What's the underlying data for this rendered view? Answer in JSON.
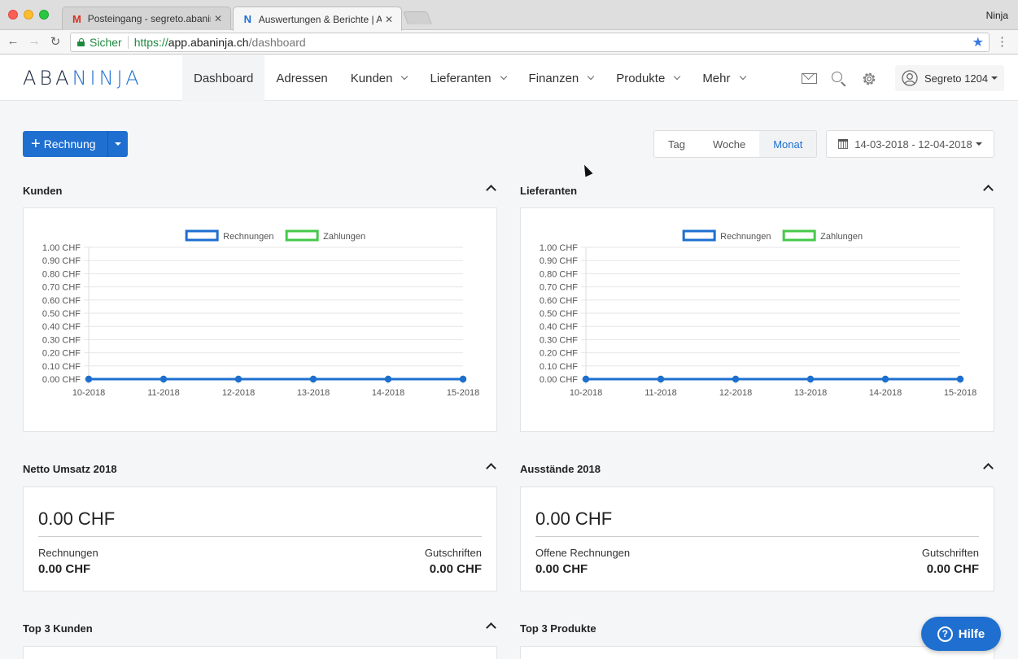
{
  "browser": {
    "tabs": [
      {
        "icon": "M",
        "title": "Posteingang - segreto.abaninja",
        "active": false,
        "icon_color": "#d93025"
      },
      {
        "icon": "N",
        "title": "Auswertungen & Berichte | Aba",
        "active": true,
        "icon_color": "#1e6fd0"
      }
    ],
    "profile_name": "Ninja",
    "address": {
      "secure_label": "Sicher",
      "scheme": "https://",
      "host": "app.abaninja.ch",
      "path": "/dashboard"
    }
  },
  "app": {
    "logo": {
      "part1": "ABA",
      "part2": "NINJA"
    },
    "nav": [
      {
        "label": "Dashboard",
        "active": true,
        "has_menu": false
      },
      {
        "label": "Adressen",
        "active": false,
        "has_menu": false
      },
      {
        "label": "Kunden",
        "active": false,
        "has_menu": true
      },
      {
        "label": "Lieferanten",
        "active": false,
        "has_menu": true
      },
      {
        "label": "Finanzen",
        "active": false,
        "has_menu": true
      },
      {
        "label": "Produkte",
        "active": false,
        "has_menu": true
      },
      {
        "label": "Mehr",
        "active": false,
        "has_menu": true
      }
    ],
    "user": {
      "name": "Segreto 1204"
    },
    "colors": {
      "primary": "#1e6fd0",
      "invoices_series": "#1e6fd0",
      "payments_series": "#45c94a"
    }
  },
  "toolbar": {
    "new_invoice_label": "Rechnung",
    "periods": [
      {
        "label": "Tag",
        "active": false
      },
      {
        "label": "Woche",
        "active": false
      },
      {
        "label": "Monat",
        "active": true
      }
    ],
    "date_range": "14-03-2018 - 12-04-2018"
  },
  "panels": {
    "customers": {
      "title": "Kunden"
    },
    "suppliers": {
      "title": "Lieferanten"
    },
    "net_revenue": {
      "title": "Netto Umsatz 2018",
      "total": "0.00 CHF",
      "left_label": "Rechnungen",
      "left_value": "0.00 CHF",
      "right_label": "Gutschriften",
      "right_value": "0.00 CHF"
    },
    "outstanding": {
      "title": "Ausstände 2018",
      "total": "0.00 CHF",
      "left_label": "Offene Rechnungen",
      "left_value": "0.00 CHF",
      "right_label": "Gutschriften",
      "right_value": "0.00 CHF"
    },
    "top_customers": {
      "title": "Top 3 Kunden"
    },
    "top_products": {
      "title": "Top 3 Produkte"
    }
  },
  "help": {
    "label": "Hilfe"
  },
  "chart_data": [
    {
      "type": "line",
      "categories": [
        "10-2018",
        "11-2018",
        "12-2018",
        "13-2018",
        "14-2018",
        "15-2018"
      ],
      "series": [
        {
          "name": "Rechnungen",
          "values": [
            0,
            0,
            0,
            0,
            0,
            0
          ]
        },
        {
          "name": "Zahlungen",
          "values": [
            0,
            0,
            0,
            0,
            0,
            0
          ]
        }
      ],
      "y_ticks": [
        "0.00 CHF",
        "0.10 CHF",
        "0.20 CHF",
        "0.30 CHF",
        "0.40 CHF",
        "0.50 CHF",
        "0.60 CHF",
        "0.70 CHF",
        "0.80 CHF",
        "0.90 CHF",
        "1.00 CHF"
      ],
      "ylim": [
        0,
        1
      ],
      "legend": "top",
      "grid": true
    },
    {
      "type": "line",
      "categories": [
        "10-2018",
        "11-2018",
        "12-2018",
        "13-2018",
        "14-2018",
        "15-2018"
      ],
      "series": [
        {
          "name": "Rechnungen",
          "values": [
            0,
            0,
            0,
            0,
            0,
            0
          ]
        },
        {
          "name": "Zahlungen",
          "values": [
            0,
            0,
            0,
            0,
            0,
            0
          ]
        }
      ],
      "y_ticks": [
        "0.00 CHF",
        "0.10 CHF",
        "0.20 CHF",
        "0.30 CHF",
        "0.40 CHF",
        "0.50 CHF",
        "0.60 CHF",
        "0.70 CHF",
        "0.80 CHF",
        "0.90 CHF",
        "1.00 CHF"
      ],
      "ylim": [
        0,
        1
      ],
      "legend": "top",
      "grid": true
    }
  ]
}
